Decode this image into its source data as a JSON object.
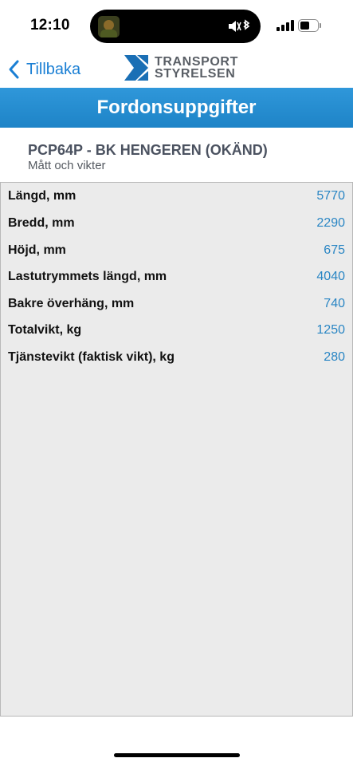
{
  "status_bar": {
    "time": "12:10"
  },
  "navbar": {
    "back_label": "Tillbaka",
    "logo_line1": "TRANSPORT",
    "logo_line2": "STYRELSEN"
  },
  "title": "Fordonsuppgifter",
  "vehicle": {
    "title": "PCP64P - BK HENGEREN (OKÄND)",
    "subtitle": "Mått och vikter"
  },
  "rows": [
    {
      "label": "Längd, mm",
      "value": "5770"
    },
    {
      "label": "Bredd, mm",
      "value": "2290"
    },
    {
      "label": "Höjd, mm",
      "value": "675"
    },
    {
      "label": "Lastutrymmets längd, mm",
      "value": "4040"
    },
    {
      "label": "Bakre överhäng, mm",
      "value": "740"
    },
    {
      "label": "Totalvikt, kg",
      "value": "1250"
    },
    {
      "label": "Tjänstevikt (faktisk vikt), kg",
      "value": "280"
    }
  ],
  "colors": {
    "accent": "#1a7fd4",
    "title_bar": "#2590d2",
    "value_text": "#2a86c4",
    "panel_bg": "#ebebeb"
  }
}
